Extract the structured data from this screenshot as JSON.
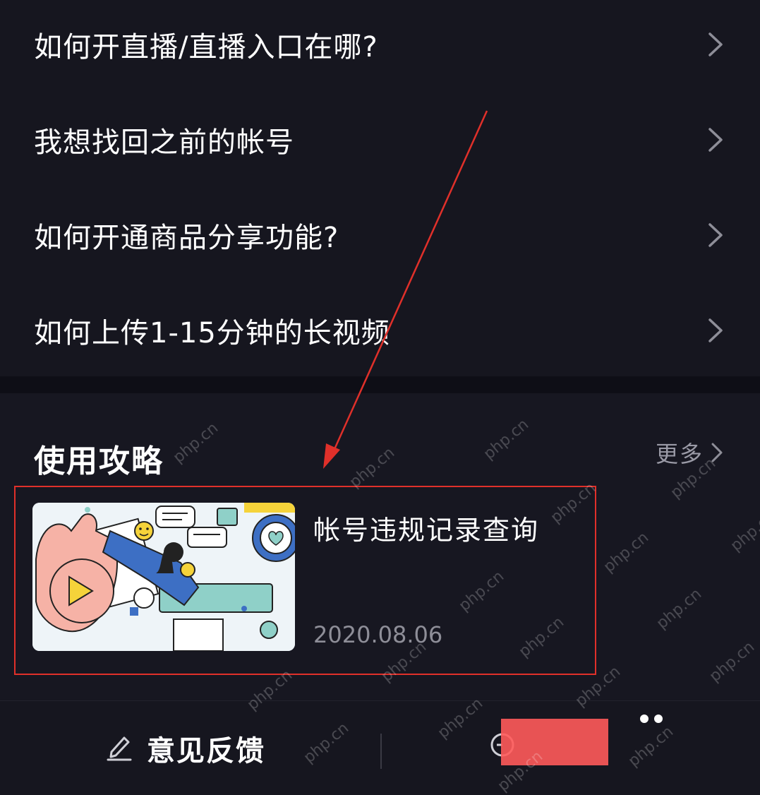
{
  "faq": {
    "items": [
      {
        "label": "如何开直播/直播入口在哪?"
      },
      {
        "label": "我想找回之前的帐号"
      },
      {
        "label": "如何开通商品分享功能?"
      },
      {
        "label": "如何上传1-15分钟的长视频"
      }
    ]
  },
  "guide": {
    "title": "使用攻略",
    "more_label": "更多",
    "card": {
      "title": "帐号违规记录查询",
      "date": "2020.08.06"
    }
  },
  "bottom_bar": {
    "feedback_label": "意见反馈"
  },
  "watermark": "php.cn",
  "colors": {
    "background": "#16161f",
    "annotation_red": "#e0302a",
    "muted_text": "#9a9aa6"
  }
}
